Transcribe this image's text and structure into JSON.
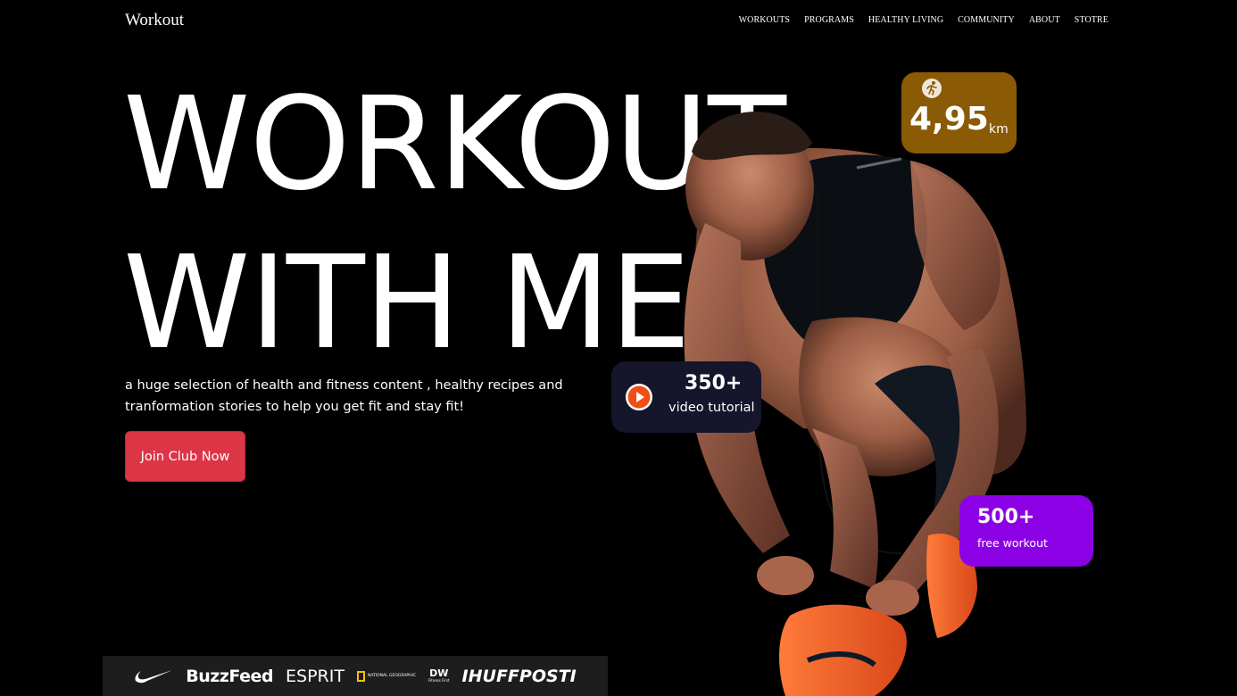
{
  "header": {
    "logo": "Workout",
    "nav": [
      {
        "label": "WORKOUTS"
      },
      {
        "label": "PROGRAMS"
      },
      {
        "label": "HEALTHY LIVING"
      },
      {
        "label": "COMMUNITY"
      },
      {
        "label": "ABOUT"
      },
      {
        "label": "STOTRE"
      }
    ]
  },
  "hero": {
    "title_line1": "WORKOUT",
    "title_line2": "WITH ME",
    "description": "a huge selection of health and fitness content , healthy recipes and tranformation stories to help you get fit and stay fit!",
    "cta_label": "Join Club Now",
    "cta_color": "#dc3545"
  },
  "stats": {
    "distance": {
      "value": "4,95",
      "unit": "km",
      "icon": "running-icon",
      "color": "#8a5a04"
    },
    "videos": {
      "value": "350+",
      "label": "video tutorial",
      "icon": "play-icon",
      "color": "#15152b"
    },
    "free": {
      "value": "500+",
      "label": "free workout",
      "color": "#8c00e6"
    }
  },
  "brands": {
    "items": [
      "nike-logo",
      "BuzzFeed",
      "ESPRIT",
      "NATIONAL GEOGRAPHIC",
      "DW",
      "HUFFPOST"
    ],
    "buzzfeed": "BuzzFeed",
    "esprit": "ESPRIT",
    "natgeo": "NATIONAL GEOGRAPHIC",
    "dw": "DW",
    "dw_sub": "Fitness First",
    "huffpost": "IHUFFPOSTI"
  }
}
